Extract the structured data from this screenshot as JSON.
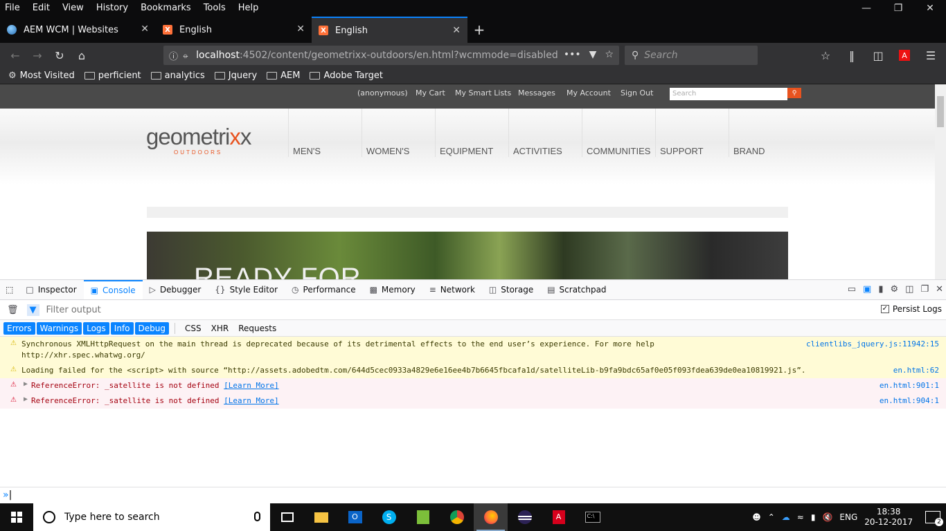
{
  "menubar": {
    "items": [
      "File",
      "Edit",
      "View",
      "History",
      "Bookmarks",
      "Tools",
      "Help"
    ]
  },
  "window_controls": {
    "minimize": "—",
    "restore": "❐",
    "close": "✕"
  },
  "tabs": [
    {
      "title": "AEM WCM | Websites",
      "close": "✕"
    },
    {
      "title": "English",
      "close": "✕"
    },
    {
      "title": "English",
      "close": "✕"
    }
  ],
  "newtab": "+",
  "url": {
    "host": "localhost",
    "path": ":4502/content/geometrixx-outdoors/en.html?wcmmode=disabled"
  },
  "search": {
    "placeholder": "Search"
  },
  "bookmarks": [
    {
      "label": "Most Visited"
    },
    {
      "label": "perficient"
    },
    {
      "label": "analytics"
    },
    {
      "label": "Jquery"
    },
    {
      "label": "AEM"
    },
    {
      "label": "Adobe Target"
    }
  ],
  "site": {
    "toplinks": [
      "(anonymous)",
      "My Cart",
      "My Smart Lists",
      "Messages",
      "My Account",
      "Sign Out"
    ],
    "search_placeholder": "Search",
    "logo_main_a": "geometri",
    "logo_main_b": "x",
    "logo_main_c": "x",
    "logo_sub": "OUTDOORS",
    "nav": [
      "MEN'S",
      "WOMEN'S",
      "EQUIPMENT",
      "ACTIVITIES",
      "COMMUNITIES",
      "SUPPORT",
      "BRAND"
    ],
    "hero_text": "READY FOR"
  },
  "devtools": {
    "tabs": [
      "Inspector",
      "Console",
      "Debugger",
      "Style Editor",
      "Performance",
      "Memory",
      "Network",
      "Storage",
      "Scratchpad"
    ],
    "filter_placeholder": "Filter output",
    "persist_label": "Persist Logs",
    "levels": [
      "Errors",
      "Warnings",
      "Logs",
      "Info",
      "Debug"
    ],
    "types": [
      "CSS",
      "XHR",
      "Requests"
    ],
    "messages": [
      {
        "level": "warn",
        "text1": "Synchronous XMLHttpRequest on the main thread is deprecated because of its detrimental effects to the end user’s experience. For more help",
        "text2": "http://xhr.spec.whatwg.org/",
        "location": "clientlibs_jquery.js:11942:15"
      },
      {
        "level": "warn",
        "text1": "Loading failed for the <script> with source “http://assets.adobedtm.com/644d5cec0933a4829e6e16ee4b7b6645fbcafa1d/satelliteLib-b9fa9bdc65af0e05f093fdea639de0ea10819921.js”.",
        "location": "en.html:62"
      },
      {
        "level": "error",
        "text1": "ReferenceError: _satellite is not defined",
        "learn": "[Learn More]",
        "location": "en.html:901:1"
      },
      {
        "level": "error",
        "text1": "ReferenceError: _satellite is not defined",
        "learn": "[Learn More]",
        "location": "en.html:904:1"
      }
    ]
  },
  "taskbar": {
    "search_placeholder": "Type here to search",
    "language": "ENG",
    "time": "18:38",
    "date": "20-12-2017",
    "notifications": "2"
  }
}
